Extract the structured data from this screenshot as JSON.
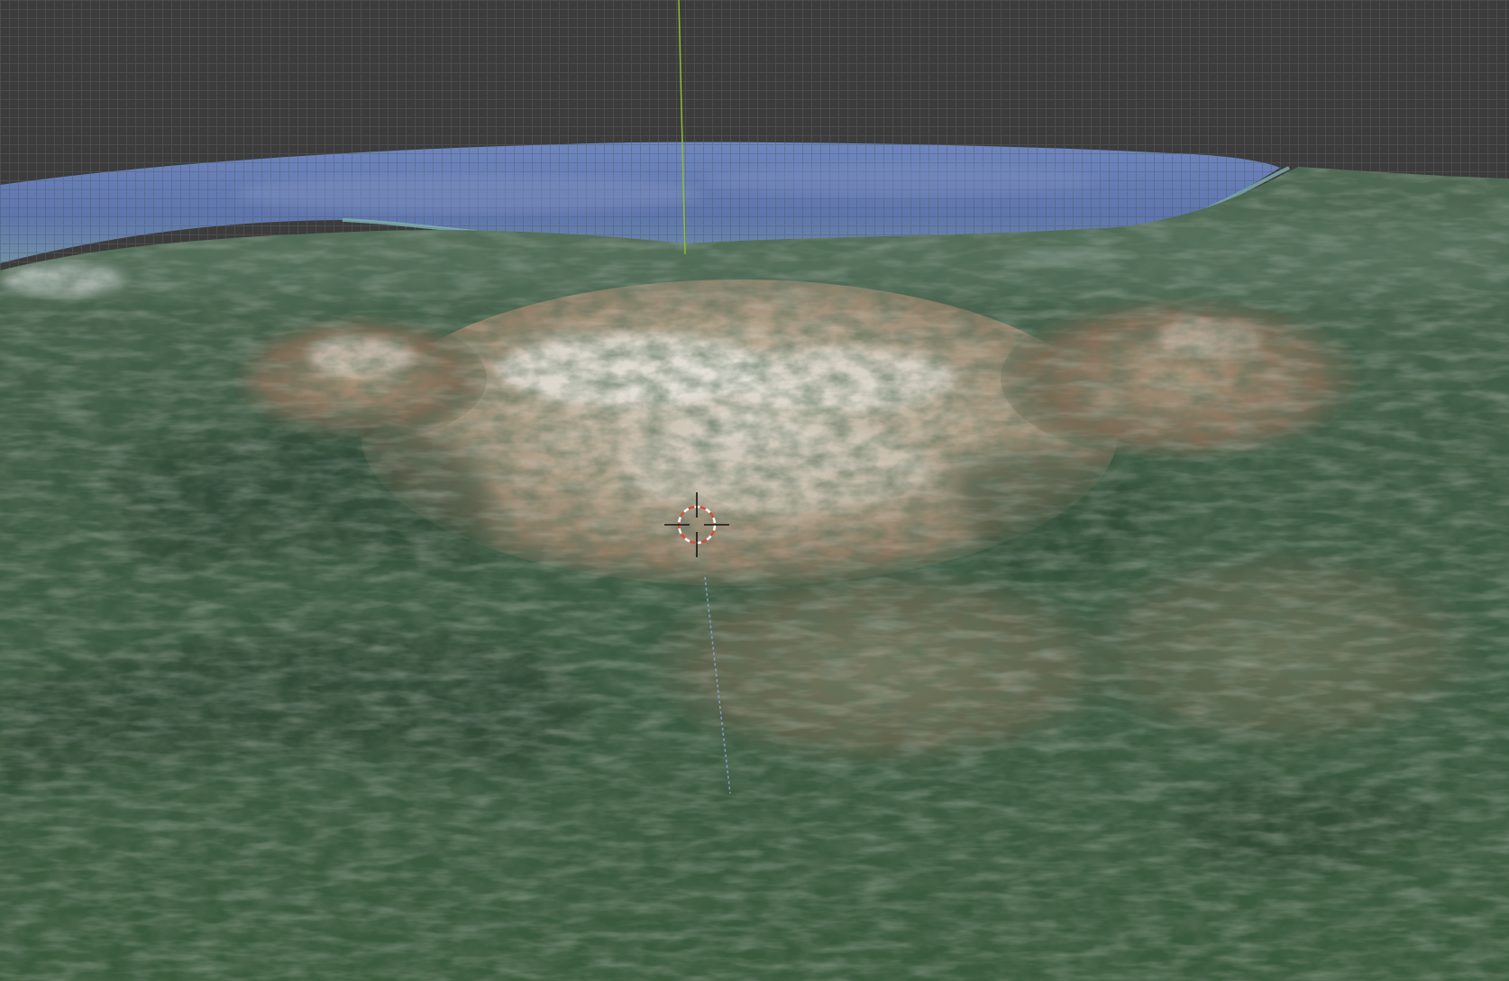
{
  "viewport": {
    "background_color": "#3d3d3d",
    "grid_color": "#4a4a4a",
    "axis_z_color": "#8fbf2f",
    "sea_color": "#5f79b0",
    "forest_color": "#3d5b44",
    "rock_color": "#b7aa95",
    "snow_color": "#e4e2dc"
  },
  "cursor": {
    "icon": "3d-cursor-icon",
    "ring_colors": [
      "#d94b3a",
      "#ffffff"
    ]
  },
  "gizmo_lines": {
    "z_axis_icon": "z-axis-line",
    "projection_icon": "projection-dashed-line"
  }
}
